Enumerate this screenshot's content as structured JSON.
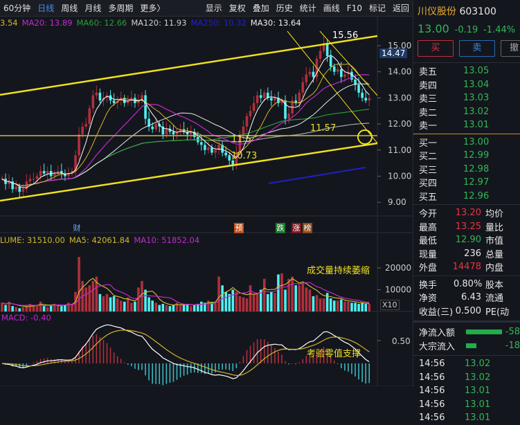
{
  "toolbar": {
    "left": [
      "60分钟",
      "日线",
      "周线",
      "月线",
      "多周期",
      "更多〉"
    ],
    "active": "日线",
    "right": [
      "显示",
      "复权",
      "叠加",
      "历史",
      "统计",
      "画线",
      "F10",
      "标记",
      "返回"
    ]
  },
  "legend": [
    {
      "text": "3.54",
      "color": "#d4b62a"
    },
    {
      "text": "MA20: 13.89",
      "color": "#c02ad0"
    },
    {
      "text": "MA60: 12.66",
      "color": "#2a9d3a"
    },
    {
      "text": "MA120: 11.93",
      "color": "#cfcfcf"
    },
    {
      "text": "MA250: 10.32",
      "color": "#2020c8"
    },
    {
      "text": "MA30: 13.64",
      "color": "#eeeeee"
    }
  ],
  "price_axis": {
    "ticks": [
      "15.00",
      "14.00",
      "13.00",
      "12.00",
      "11.00",
      "10.00",
      "9.00"
    ],
    "range": [
      9,
      15
    ],
    "current_tag": "14.47"
  },
  "annotations": {
    "high": "15.56",
    "support": "11.57",
    "low_a": "11.5",
    "low_b": "10.73",
    "volume_note": "成交量持续萎缩",
    "macd_note": "考验零值支撑"
  },
  "chart_data": {
    "type": "candlestick",
    "closes": [
      9.9,
      9.7,
      9.8,
      9.5,
      9.6,
      9.4,
      9.5,
      9.8,
      9.9,
      9.9,
      10.0,
      10.2,
      10.1,
      10.2,
      10.0,
      10.1,
      10.2,
      10.1,
      10.0,
      10.1,
      10.2,
      10.8,
      11.6,
      11.9,
      12.0,
      12.6,
      13.1,
      13.2,
      12.9,
      13.0,
      13.1,
      12.9,
      12.8,
      12.9,
      13.0,
      12.8,
      12.9,
      13.0,
      12.8,
      12.9,
      13.1,
      12.2,
      11.9,
      11.8,
      12.0,
      11.9,
      11.6,
      11.8,
      11.7,
      11.6,
      11.7,
      11.8,
      11.7,
      11.6,
      11.7,
      11.5,
      11.3,
      11.2,
      11.0,
      11.1,
      10.9,
      11.0,
      11.2,
      10.9,
      10.8,
      10.6,
      10.4,
      10.9,
      11.6,
      11.9,
      12.3,
      12.5,
      12.8,
      13.1,
      13.0,
      13.2,
      13.0,
      12.9,
      13.0,
      12.8,
      12.9,
      12.2,
      12.4,
      12.9,
      12.8,
      13.2,
      13.6,
      13.9,
      14.0,
      13.8,
      14.5,
      14.8,
      15.1,
      14.6,
      14.2,
      14.0,
      14.1,
      13.8,
      13.9,
      14.0,
      13.7,
      13.5,
      13.2,
      13.0,
      12.9,
      13.0
    ],
    "volumes": [
      4000,
      3000,
      4500,
      2500,
      2000,
      1500,
      2000,
      3000,
      3500,
      2500,
      3000,
      4500,
      2500,
      2000,
      3000,
      3500,
      3000,
      2500,
      3000,
      4000,
      3500,
      9000,
      25000,
      14000,
      11000,
      12000,
      14000,
      16000,
      8000,
      7000,
      8000,
      6500,
      7000,
      6000,
      5000,
      4500,
      6500,
      4000,
      4500,
      11000,
      14000,
      10000,
      6500,
      5000,
      4000,
      3000,
      3500,
      3000,
      2500,
      3000,
      4000,
      3000,
      3000,
      3500,
      2500,
      3000,
      3500,
      4500,
      4000,
      5000,
      4000,
      3500,
      16000,
      12000,
      9000,
      8000,
      10000,
      9000,
      7000,
      6500,
      6000,
      12000,
      8000,
      8500,
      10000,
      15000,
      8000,
      9000,
      8500,
      17000,
      17500,
      10000,
      15000,
      16000,
      12000,
      12000,
      13000,
      11000,
      10000,
      7000,
      7500,
      6000,
      6000,
      8500,
      6000,
      5000,
      5000,
      5500,
      4500,
      4500,
      4000,
      4000,
      3500,
      4000,
      3500,
      3500
    ],
    "up_color": "#b0303c",
    "down_color": "#4ff0f0"
  },
  "markers": [
    {
      "text": "财",
      "bg": "transparent",
      "color": "#6aa8ff"
    },
    {
      "text": "预",
      "bg": "#c0501a",
      "color": "#fff"
    },
    {
      "text": "跌",
      "bg": "#1a7a2a",
      "color": "#fff"
    },
    {
      "text": "涨",
      "bg": "#7a1a22",
      "color": "#fff"
    },
    {
      "text": "榜",
      "bg": "#8a4a1a",
      "color": "#fff"
    }
  ],
  "volume": {
    "legend": [
      {
        "text": "LUME: 31510.00",
        "color": "#d4b62a"
      },
      {
        "text": "MA5: 42061.84",
        "color": "#d4b62a"
      },
      {
        "text": "MA10: 51852.04",
        "color": "#c02ad0"
      }
    ],
    "ticks": [
      "20000",
      "10000"
    ],
    "unit": "X10"
  },
  "macd": {
    "legend": "MACD: -0.40",
    "ticks": [
      "0.50"
    ]
  },
  "stock": {
    "name": "川仪股份",
    "code": "603100",
    "price": "13.00",
    "change": "-0.19",
    "pct": "-1.44%",
    "buy": "买",
    "sell": "卖",
    "cancel": "撤"
  },
  "asks": [
    {
      "l": "卖五",
      "p": "13.05"
    },
    {
      "l": "卖四",
      "p": "13.04"
    },
    {
      "l": "卖三",
      "p": "13.03"
    },
    {
      "l": "卖二",
      "p": "13.02"
    },
    {
      "l": "卖一",
      "p": "13.01"
    }
  ],
  "bids": [
    {
      "l": "买一",
      "p": "13.00"
    },
    {
      "l": "买二",
      "p": "12.99"
    },
    {
      "l": "买三",
      "p": "12.98"
    },
    {
      "l": "买四",
      "p": "12.97"
    },
    {
      "l": "买五",
      "p": "12.96"
    }
  ],
  "stats1": [
    {
      "l": "今开",
      "v": "13.20",
      "c": "r",
      "l2": "均价"
    },
    {
      "l": "最高",
      "v": "13.25",
      "c": "r",
      "l2": "量比"
    },
    {
      "l": "最低",
      "v": "12.90",
      "c": "g",
      "l2": "市值"
    },
    {
      "l": "现量",
      "v": "236",
      "c": "w",
      "l2": "总量"
    },
    {
      "l": "外盘",
      "v": "14478",
      "c": "r",
      "l2": "内盘"
    }
  ],
  "stats2": [
    {
      "l": "换手",
      "v": "0.80%",
      "l2": "股本"
    },
    {
      "l": "净资",
      "v": "6.43",
      "l2": "流通"
    },
    {
      "l": "收益(三)",
      "v": "0.500",
      "l2": "PE(动"
    }
  ],
  "flows": [
    {
      "l": "净流入额",
      "v": "-58",
      "bar": 1.0
    },
    {
      "l": "大宗流入",
      "v": "-18",
      "bar": 0.3
    }
  ],
  "ticks": [
    {
      "t": "14:56",
      "p": "13.02"
    },
    {
      "t": "14:56",
      "p": "13.02"
    },
    {
      "t": "14:56",
      "p": "13.01"
    },
    {
      "t": "14:56",
      "p": "13.01"
    },
    {
      "t": "14:56",
      "p": "13.01"
    }
  ]
}
